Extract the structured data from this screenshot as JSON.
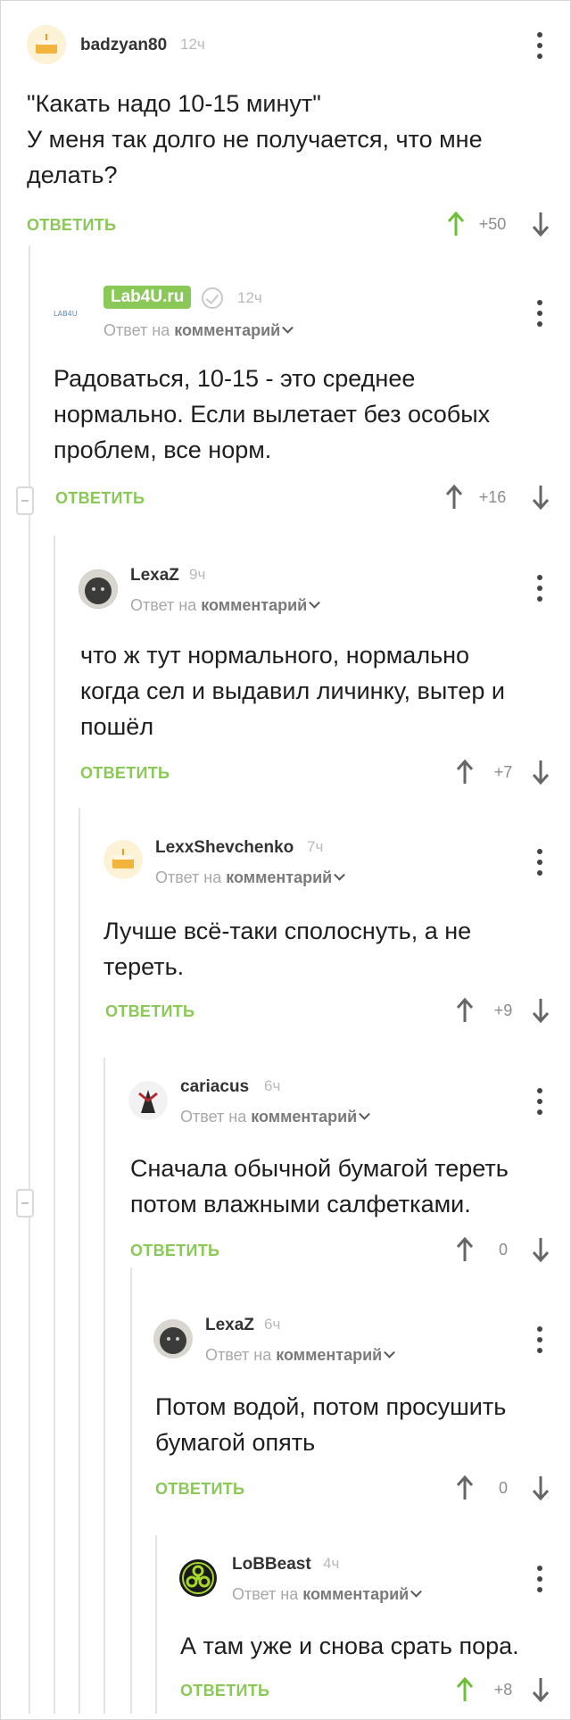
{
  "colors": {
    "accent": "#8ac858",
    "text": "#1e1e1e",
    "muted": "#a8a8a8"
  },
  "comments": [
    {
      "author": "badzyan80",
      "time": "12ч",
      "reply_to": "",
      "text": "\"Какать надо 10-15 минут\"\nУ меня так долго не получается, что мне делать?",
      "reply_label": "ОТВЕТИТЬ",
      "score": "+50",
      "avatar_icon": "cake-avatar-icon",
      "up_active": true
    },
    {
      "author": "Lab4U.ru",
      "time": "12ч",
      "reply_to_prefix": "Ответ на",
      "reply_to": "комментарий",
      "text": "Радоваться, 10-15 - это среднее нормально. Если вылетает без особых проблем, все норм.",
      "reply_label": "ОТВЕТИТЬ",
      "score": "+16",
      "avatar_icon": "lab4u-logo-icon",
      "avatar_text": "LAB4U",
      "up_active": false
    },
    {
      "author": "LexaZ",
      "time": "9ч",
      "reply_to_prefix": "Ответ на",
      "reply_to": "комментарий",
      "text": "что ж тут нормального, нормально когда сел и выдавил личинку, вытер и пошёл",
      "reply_label": "ОТВЕТИТЬ",
      "score": "+7",
      "avatar_icon": "photo-avatar-icon",
      "up_active": false
    },
    {
      "author": "LexxShevchenko",
      "time": "7ч",
      "reply_to_prefix": "Ответ на",
      "reply_to": "комментарий",
      "text": "Лучше всё-таки сполоснуть, а не тереть.",
      "reply_label": "ОТВЕТИТЬ",
      "score": "+9",
      "avatar_icon": "cake-avatar-icon",
      "up_active": false
    },
    {
      "author": "cariacus",
      "time": "6ч",
      "reply_to_prefix": "Ответ на",
      "reply_to": "комментарий",
      "text": "Сначала обычной бумагой тереть потом влажными салфетками.",
      "reply_label": "ОТВЕТИТЬ",
      "score": "0",
      "avatar_icon": "dark-figure-avatar-icon",
      "up_active": false
    },
    {
      "author": "LexaZ",
      "time": "6ч",
      "reply_to_prefix": "Ответ на",
      "reply_to": "комментарий",
      "text": "Потом водой, потом просушить бумагой опять",
      "reply_label": "ОТВЕТИТЬ",
      "score": "0",
      "avatar_icon": "photo-avatar-icon",
      "up_active": false
    },
    {
      "author": "LoBBeast",
      "time": "4ч",
      "reply_to_prefix": "Ответ на",
      "reply_to": "комментарий",
      "text": "А там уже и снова срать пора.",
      "reply_label": "ОТВЕТИТЬ",
      "score": "+8",
      "avatar_icon": "biohazard-avatar-icon",
      "up_active": true
    }
  ]
}
